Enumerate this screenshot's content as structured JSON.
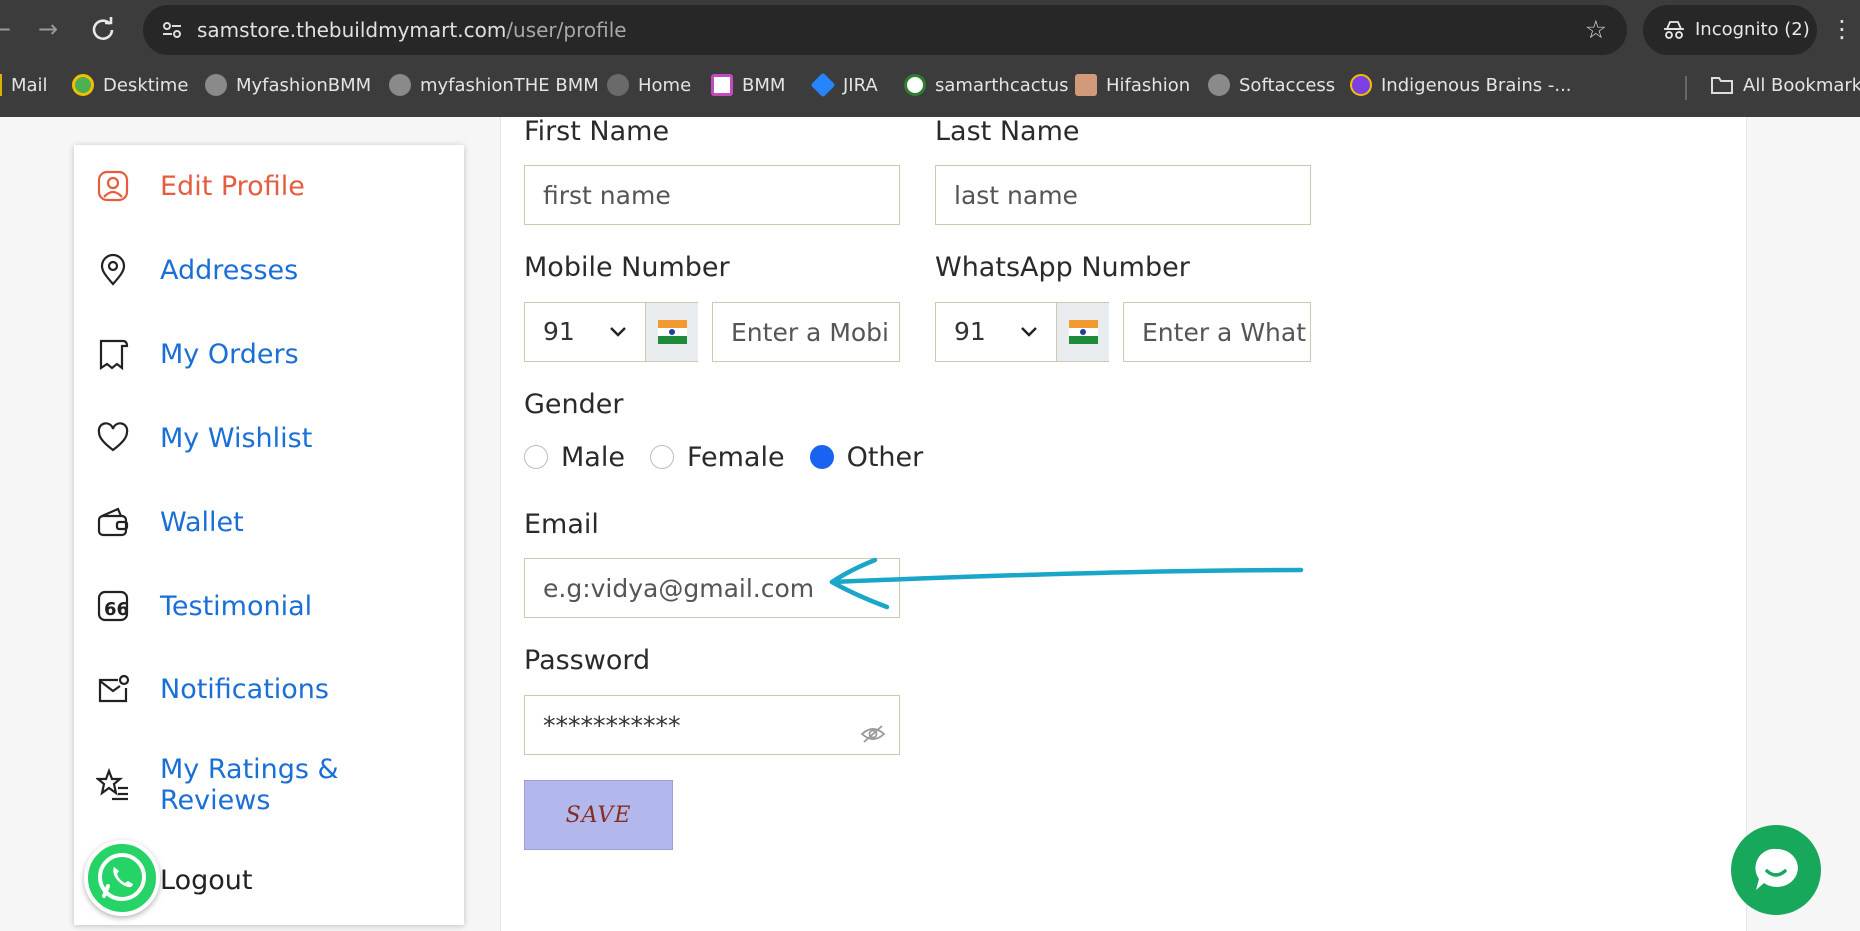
{
  "browser": {
    "url_domain": "samstore.thebuildmymart.com",
    "url_path": "/user/profile",
    "incognito_label": "Incognito (2)",
    "bookmarks": [
      {
        "label": "Mail",
        "color": "#e0b100"
      },
      {
        "label": "Desktime",
        "color": "#4caf50"
      },
      {
        "label": "MyfashionBMM",
        "color": "#8a8a8a"
      },
      {
        "label": "myfashionTHE BMM",
        "color": "#8a8a8a"
      },
      {
        "label": "Home",
        "color": "#6a6a6a"
      },
      {
        "label": "BMM",
        "color": "#c04cc0"
      },
      {
        "label": "JIRA",
        "color": "#2684ff"
      },
      {
        "label": "samarthcactus",
        "color": "#2e7d32"
      },
      {
        "label": "Hifashion",
        "color": "#d29a7a"
      },
      {
        "label": "Softaccess",
        "color": "#8a8a8a"
      },
      {
        "label": "Indigenous Brains -...",
        "color": "#7b3fe4"
      },
      {
        "label": "All Bookmarks",
        "color": "#cccccc"
      }
    ]
  },
  "sidebar": {
    "items": [
      {
        "label": "Edit Profile",
        "icon": "user-icon"
      },
      {
        "label": "Addresses",
        "icon": "location-pin-icon"
      },
      {
        "label": "My Orders",
        "icon": "receipt-icon"
      },
      {
        "label": "My Wishlist",
        "icon": "heart-icon"
      },
      {
        "label": "Wallet",
        "icon": "wallet-icon"
      },
      {
        "label": "Testimonial",
        "icon": "quote-icon"
      },
      {
        "label": "Notifications",
        "icon": "mail-notification-icon"
      },
      {
        "label": "My Ratings & Reviews",
        "icon": "star-list-icon"
      },
      {
        "label": "Logout",
        "icon": "logout-icon"
      }
    ],
    "ratings_line1": "My Ratings &",
    "ratings_line2": "Reviews"
  },
  "form": {
    "first_name_label": "First Name",
    "first_name_placeholder": "first name",
    "last_name_label": "Last Name",
    "last_name_placeholder": "last name",
    "mobile_label": "Mobile Number",
    "mobile_code": "91",
    "mobile_placeholder": "Enter a Mobi",
    "whatsapp_label": "WhatsApp Number",
    "whatsapp_code": "91",
    "whatsapp_placeholder": "Enter a What",
    "gender_label": "Gender",
    "gender_options": [
      "Male",
      "Female",
      "Other"
    ],
    "gender_selected": "Other",
    "email_label": "Email",
    "email_placeholder": "e.g:vidya@gmail.com",
    "password_label": "Password",
    "password_value": "***********",
    "save_label": "SAVE"
  },
  "colors": {
    "accent_active": "#e65c3e",
    "link": "#1a6fd6",
    "annotation_arrow": "#1aa6c8",
    "save_bg": "#b3b8ec"
  }
}
